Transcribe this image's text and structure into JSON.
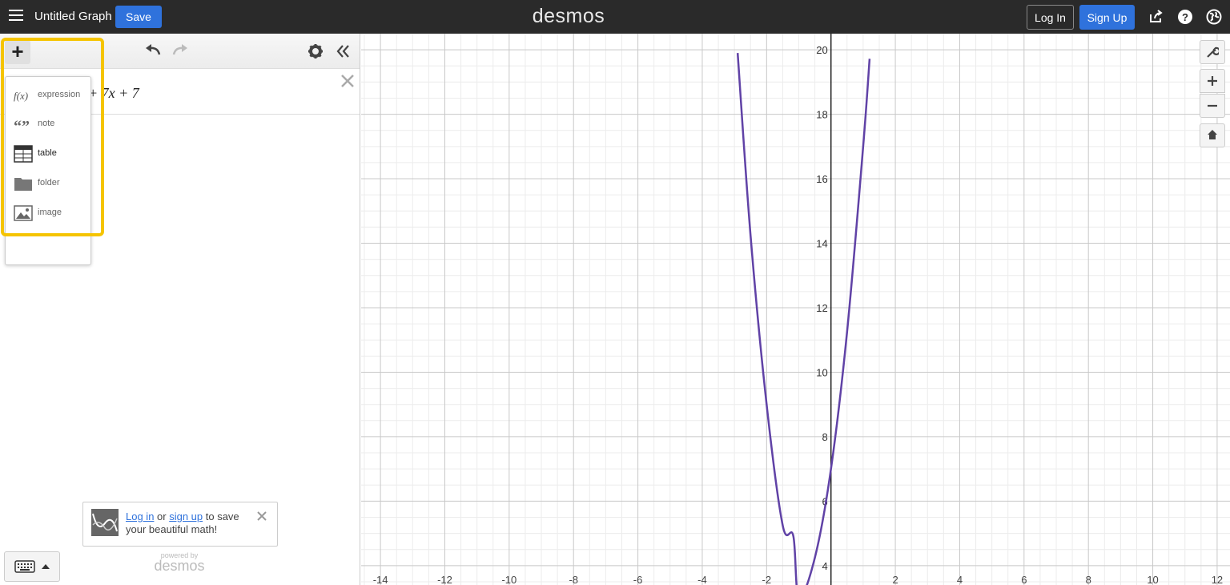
{
  "header": {
    "title": "Untitled Graph",
    "save_label": "Save",
    "logo": "desmos",
    "login_label": "Log In",
    "signup_label": "Sign Up"
  },
  "expression": {
    "visible_text": "+ 7x + 7"
  },
  "add_menu": {
    "items": [
      {
        "label": "expression",
        "icon": "function-icon"
      },
      {
        "label": "note",
        "icon": "quote-icon"
      },
      {
        "label": "table",
        "icon": "table-icon"
      },
      {
        "label": "folder",
        "icon": "folder-icon"
      },
      {
        "label": "image",
        "icon": "image-icon"
      }
    ]
  },
  "promo": {
    "login_link": "Log in",
    "or_text": " or ",
    "signup_link": "sign up",
    "rest": " to save your beautiful math!"
  },
  "powered": {
    "small": "powered by",
    "logo": "desmos"
  },
  "colors": {
    "accent": "#2f72dc",
    "curve": "#6042a6",
    "highlight": "#f5c400",
    "topbar": "#2a2a2a"
  },
  "chart_data": {
    "type": "line",
    "series": [
      {
        "function": "3x^2 + 7x + 7",
        "color": "#6042a6",
        "x": [
          -2.9,
          -2.5,
          -2,
          -1.5,
          -1.17,
          -1,
          -0.5,
          0,
          0.5,
          1,
          1.2
        ],
        "y": [
          19.9,
          14.25,
          9,
          5.25,
          4.92,
          3,
          4.25,
          7,
          11.25,
          17,
          19.72
        ]
      }
    ],
    "xlim": [
      -14.6,
      12.4
    ],
    "ylim": [
      3.4,
      20.5
    ],
    "x_ticks": [
      -14,
      -12,
      -10,
      -8,
      -6,
      -4,
      -2,
      2,
      4,
      6,
      8,
      10,
      12
    ],
    "y_ticks": [
      4,
      6,
      8,
      10,
      12,
      14,
      16,
      18,
      20
    ],
    "grid": true
  }
}
